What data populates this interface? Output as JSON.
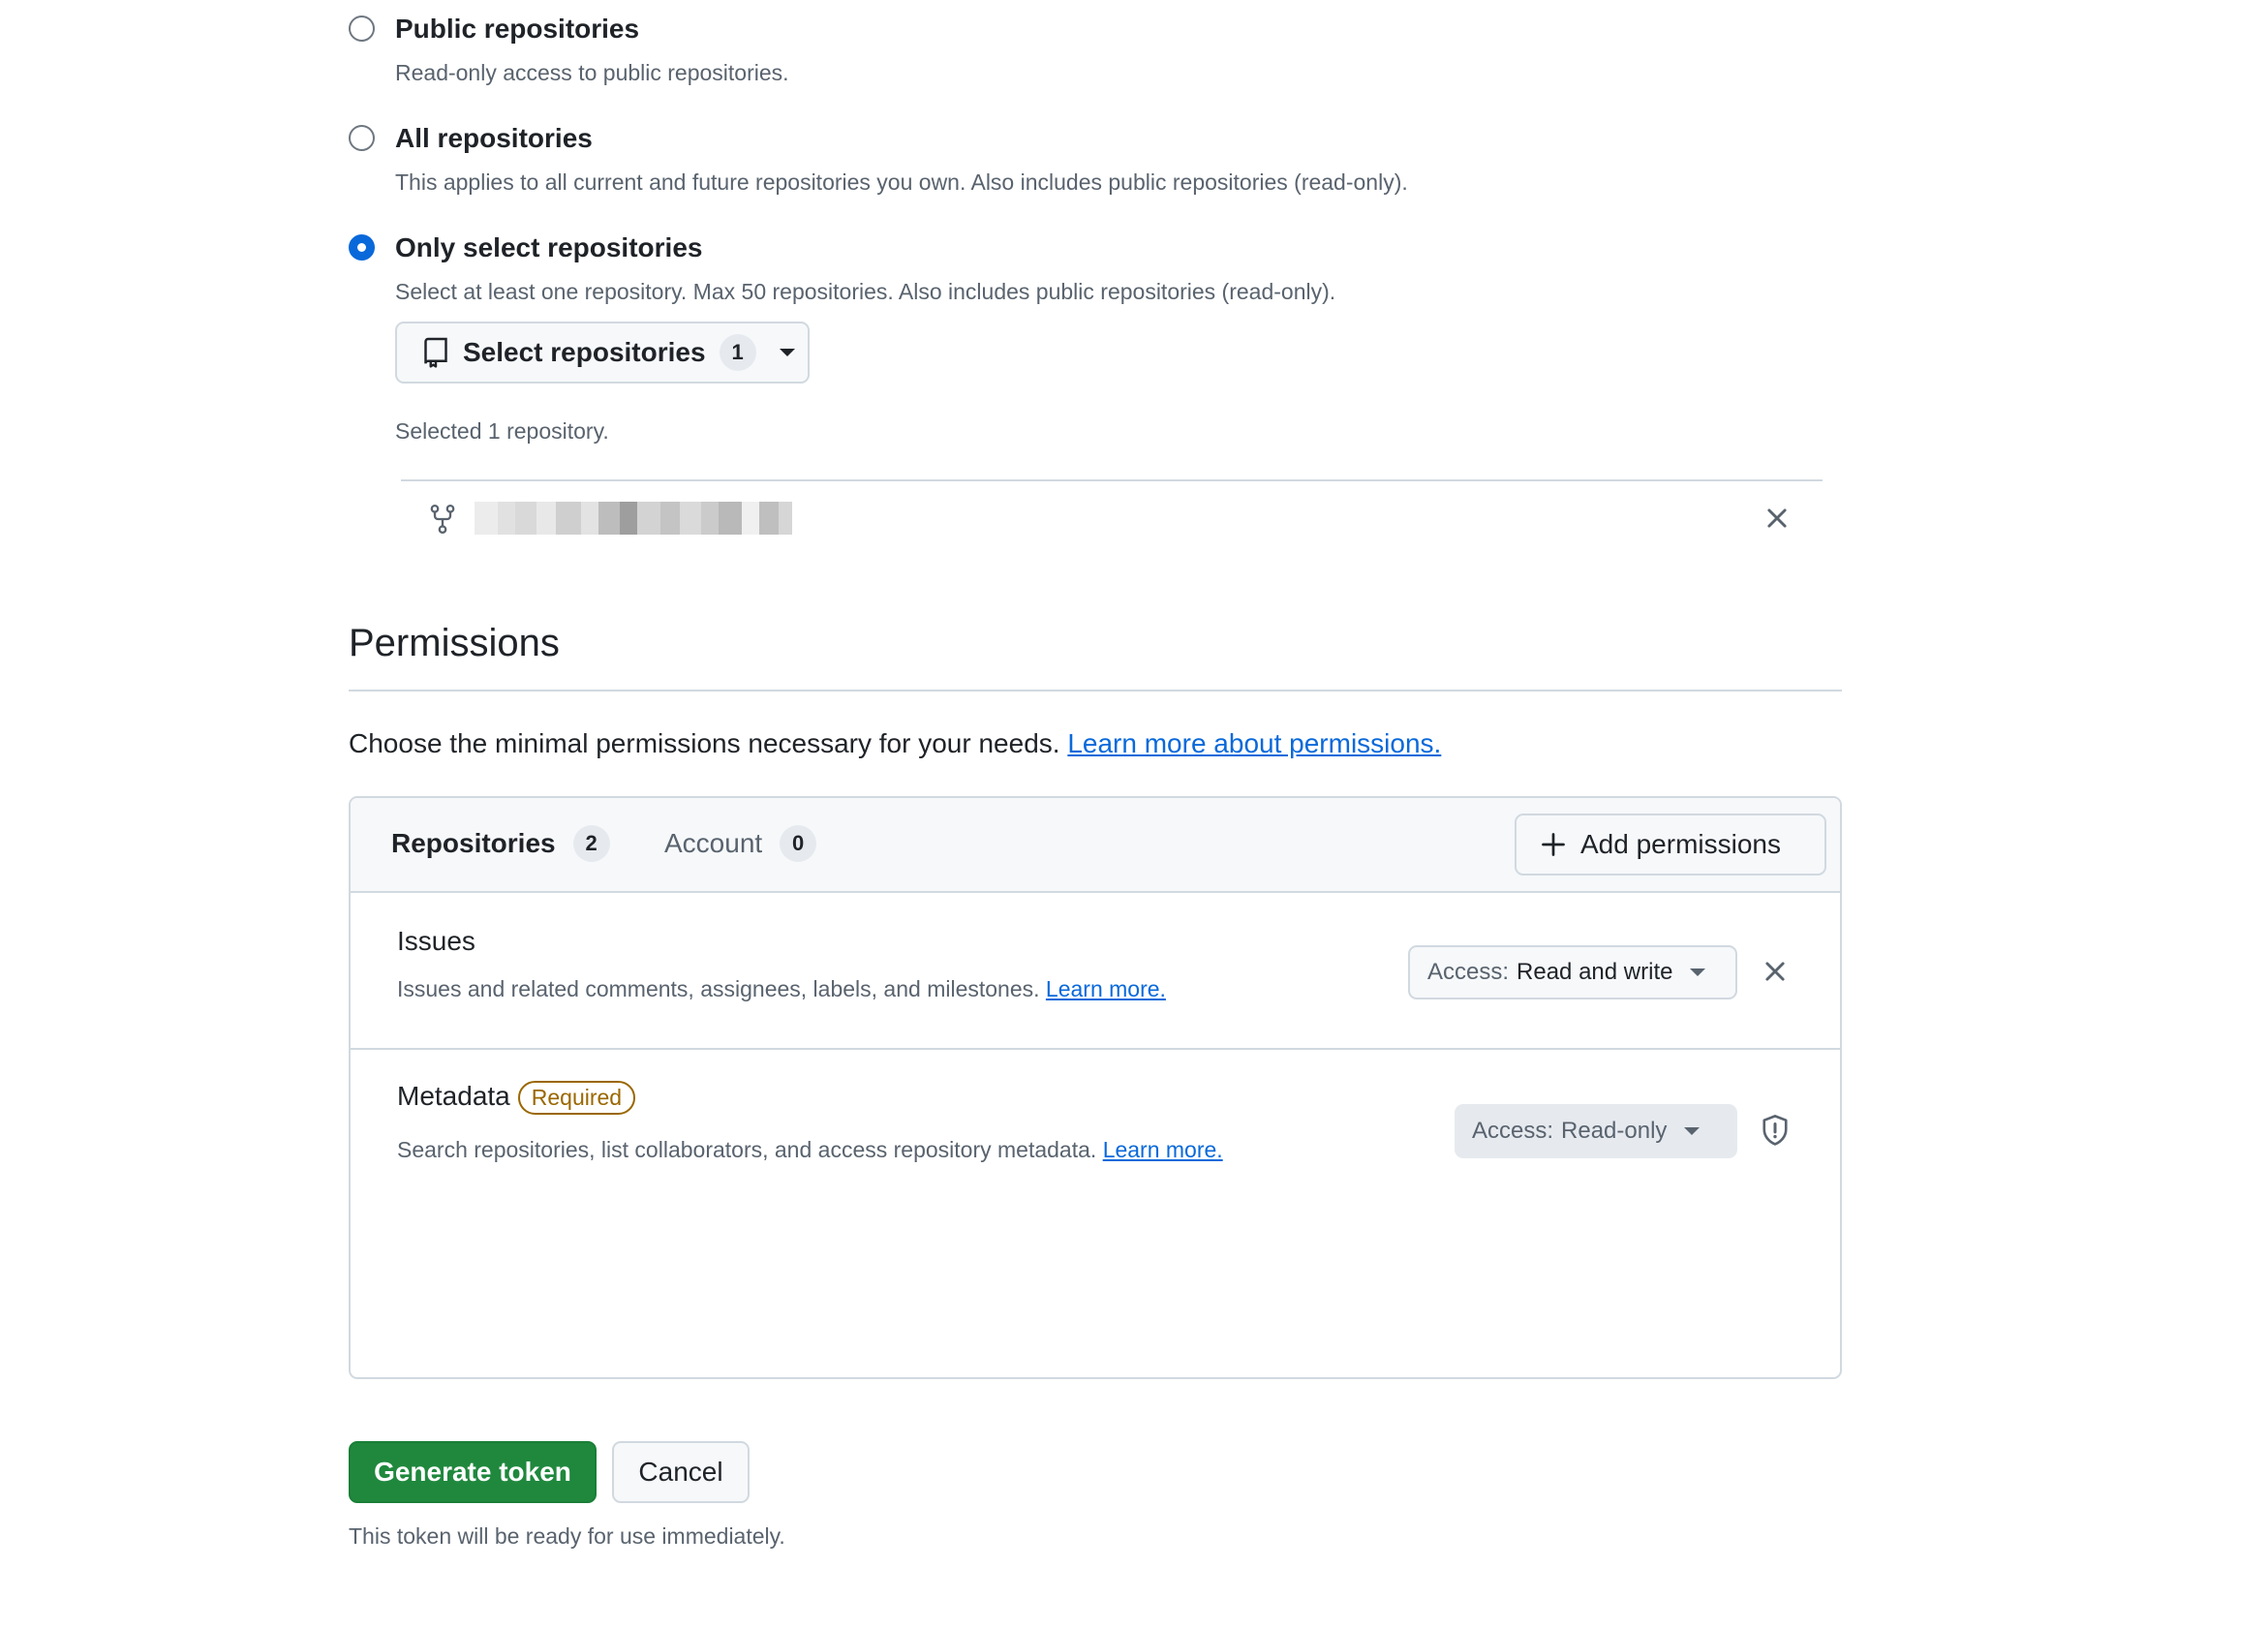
{
  "repository_access": {
    "options": [
      {
        "title": "Public repositories",
        "description": "Read-only access to public repositories.",
        "selected": false
      },
      {
        "title": "All repositories",
        "description": "This applies to all current and future repositories you own. Also includes public repositories (read-only).",
        "selected": false
      },
      {
        "title": "Only select repositories",
        "description": "Select at least one repository. Max 50 repositories. Also includes public repositories (read-only).",
        "selected": true
      }
    ],
    "select_button": {
      "label": "Select repositories",
      "count": "1"
    },
    "selected_summary": "Selected 1 repository."
  },
  "permissions": {
    "heading": "Permissions",
    "intro": "Choose the minimal permissions necessary for your needs.",
    "intro_link": "Learn more about permissions.",
    "tabs": [
      {
        "label": "Repositories",
        "count": "2"
      },
      {
        "label": "Account",
        "count": "0"
      }
    ],
    "add_button": "Add permissions",
    "items": [
      {
        "name": "Issues",
        "description": "Issues and related comments, assignees, labels, and milestones.",
        "link": "Learn more.",
        "access_prefix": "Access:",
        "access_value": "Read and write"
      },
      {
        "name": "Metadata",
        "badge": "Required",
        "description": "Search repositories, list collaborators, and access repository metadata.",
        "link": "Learn more.",
        "access_prefix": "Access:",
        "access_value": "Read-only"
      }
    ]
  },
  "actions": {
    "generate": "Generate token",
    "cancel": "Cancel",
    "note": "This token will be ready for use immediately."
  },
  "colors": {
    "accent": "#0969da",
    "primary_button": "#1f883d",
    "required_badge": "#9a6700"
  }
}
